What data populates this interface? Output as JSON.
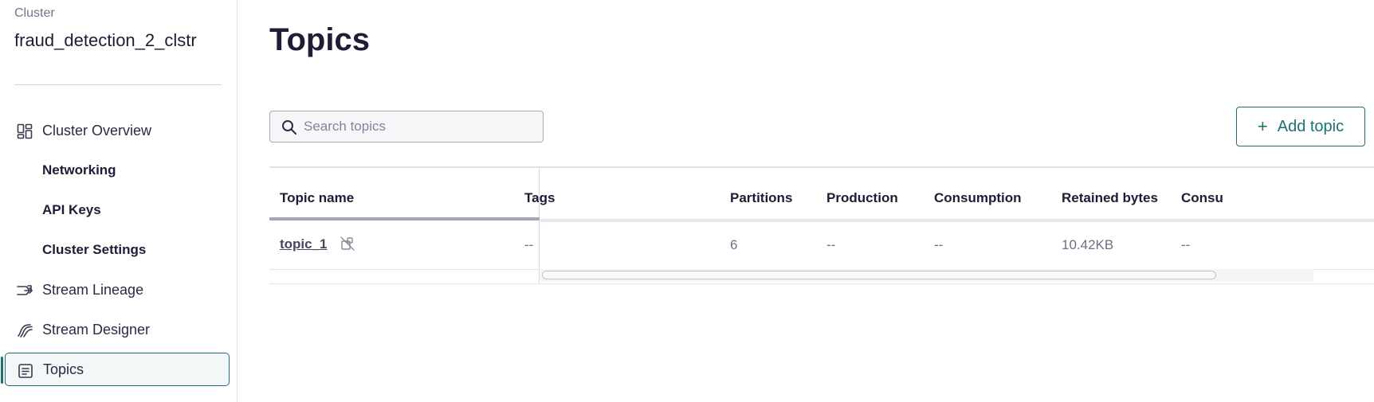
{
  "sidebar": {
    "caption": "Cluster",
    "cluster_name": "fraud_detection_2_clstr",
    "items": [
      {
        "label": "Cluster Overview",
        "icon": "dashboard-icon"
      },
      {
        "label": "Networking"
      },
      {
        "label": "API Keys"
      },
      {
        "label": "Cluster Settings"
      },
      {
        "label": "Stream Lineage",
        "icon": "stream-lineage-icon"
      },
      {
        "label": "Stream Designer",
        "icon": "stream-designer-icon"
      },
      {
        "label": "Topics",
        "icon": "topics-icon",
        "active": true
      }
    ]
  },
  "main": {
    "title": "Topics",
    "search": {
      "placeholder": "Search topics",
      "value": ""
    },
    "add_button": {
      "label": "Add topic",
      "icon": "plus-icon"
    },
    "table": {
      "columns": [
        "Topic name",
        "Tags",
        "Partitions",
        "Production",
        "Consumption",
        "Retained bytes",
        "Consu"
      ],
      "rows": [
        {
          "topic_name": "topic_1",
          "status_icon": "no-schema-icon",
          "tags": "--",
          "partitions": "6",
          "production": "--",
          "consumption": "--",
          "retained_bytes": "10.42KB",
          "consu": "--"
        }
      ]
    }
  },
  "colors": {
    "accent": "#1e6f73",
    "text_dark": "#1d1d36",
    "text_muted": "#6e6e84",
    "border": "#e2e2e8"
  }
}
